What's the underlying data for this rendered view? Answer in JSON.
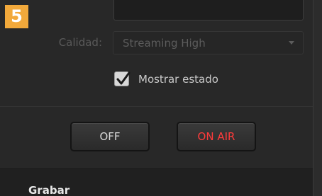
{
  "step": {
    "number": "5",
    "color": "#f2a93b"
  },
  "quality": {
    "label": "Calidad:",
    "value": "Streaming High",
    "dropdown_icon": "chevron-down-icon"
  },
  "show_status": {
    "label": "Mostrar estado",
    "checked": true,
    "check_icon": "checkmark-icon"
  },
  "buttons": {
    "off_label": "OFF",
    "on_air_label": "ON AIR",
    "on_air_color": "#ff3b3b"
  },
  "record_section": {
    "title": "Grabar"
  }
}
